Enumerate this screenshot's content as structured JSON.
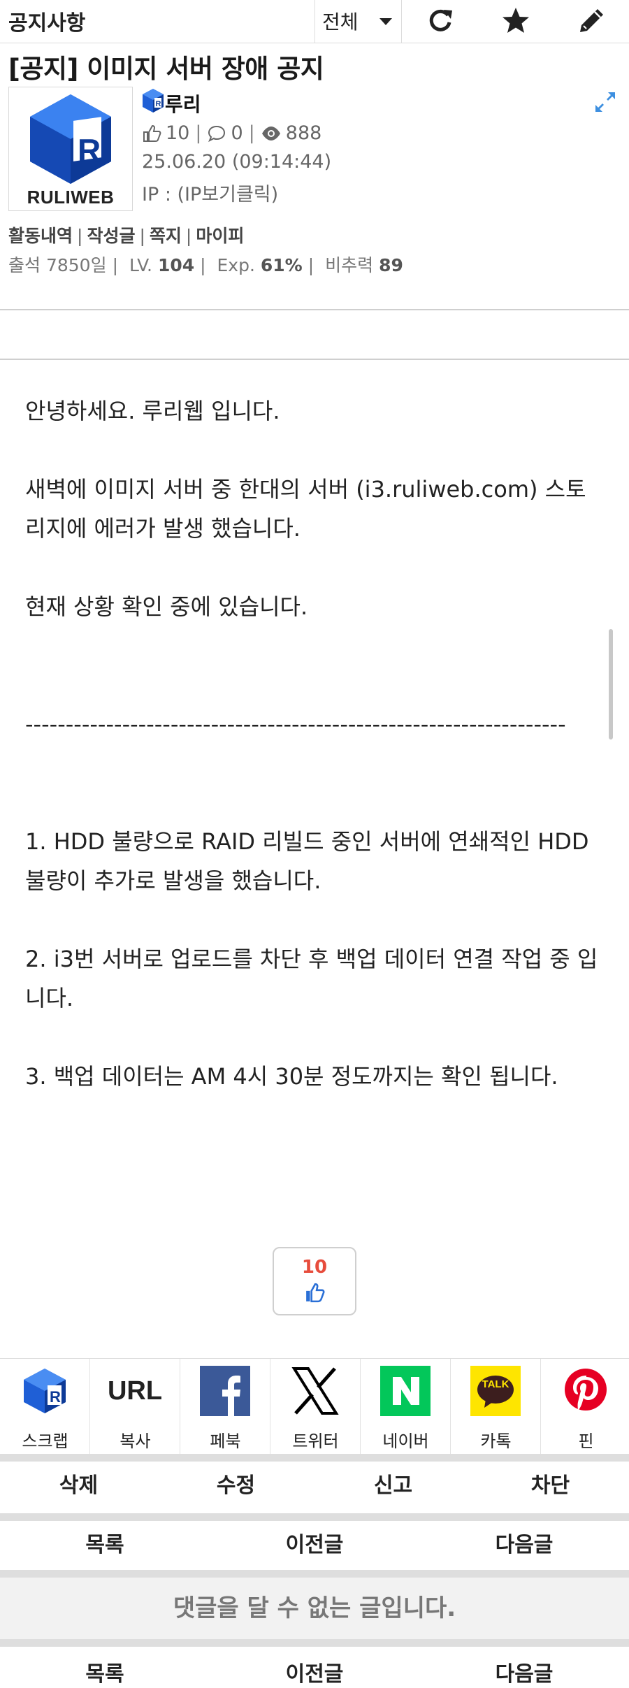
{
  "header": {
    "board_name": "공지사항",
    "category_value": "전체",
    "icons": [
      "refresh-icon",
      "star-icon",
      "pencil-icon"
    ]
  },
  "post": {
    "title": "[공지] 이미지 서버 장애 공지",
    "author": {
      "avatar_logo_text": "RULIWEB",
      "nickname": "루리",
      "likes": "10",
      "comments": "0",
      "views": "888",
      "date": "25.06.20 (09:14:44)",
      "ip": "IP : (IP보기클릭)"
    },
    "profile_links": [
      "활동내역",
      "작성글",
      "쪽지",
      "마이피"
    ],
    "levels": {
      "attendance": "출석 7850일",
      "lv_label": "LV.",
      "lv_value": "104",
      "exp_label": "Exp.",
      "exp_value": "61%",
      "power_label": "비추력",
      "power_value": "89"
    },
    "body_lines": [
      "안녕하세요. 루리웹 입니다.",
      "",
      "새벽에 이미지 서버 중 한대의 서버 (i3.ruliweb.com) 스토리지에 에러가 발생 했습니다.",
      "",
      "현재 상황 확인 중에 있습니다.",
      "",
      "",
      "-------------------------------------------------------------------",
      "",
      "",
      "1. HDD 불량으로 RAID 리빌드 중인 서버에 연쇄적인 HDD 불량이 추가로 발생을 했습니다.",
      "",
      "2. i3번 서버로 업로드를 차단 후 백업 데이터 연결 작업 중 입니다.",
      "",
      "3. 백업 데이터는 AM 4시 30분 정도까지는 확인 됩니다."
    ],
    "recommend_count": "10"
  },
  "share": [
    {
      "label": "스크랩",
      "icon": "ruliweb-scrap-icon"
    },
    {
      "label": "복사",
      "icon_text": "URL",
      "icon": "url-copy-icon"
    },
    {
      "label": "페북",
      "icon": "facebook-icon",
      "color": "#3b5998"
    },
    {
      "label": "트위터",
      "icon": "x-icon",
      "color": "#000000"
    },
    {
      "label": "네이버",
      "icon": "naver-icon",
      "color": "#03c75a"
    },
    {
      "label": "카톡",
      "icon_text": "TALK",
      "icon": "kakaotalk-icon",
      "color": "#fee500"
    },
    {
      "label": "핀",
      "icon": "pinterest-icon",
      "color": "#e60023"
    }
  ],
  "actions": {
    "delete": "삭제",
    "edit": "수정",
    "report": "신고",
    "block": "차단"
  },
  "nav": {
    "list": "목록",
    "prev": "이전글",
    "next": "다음글"
  },
  "no_comment_text": "댓글을 달 수 없는 글입니다.",
  "colors": {
    "brand_blue": "#1a56c8",
    "recommend_red": "#e74c3c",
    "thumb_blue": "#2a6fd6"
  }
}
